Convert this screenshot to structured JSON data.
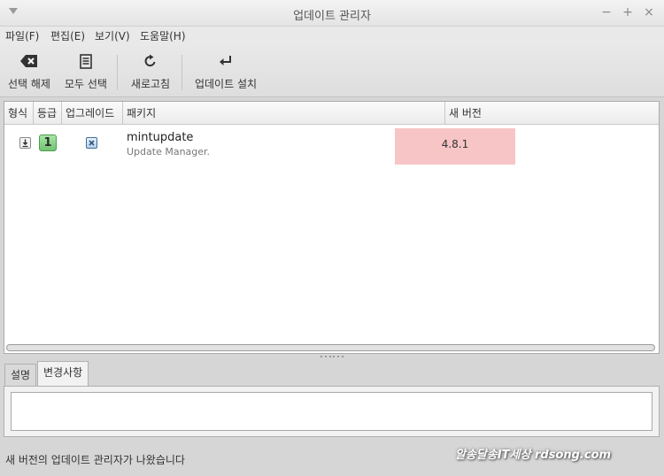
{
  "window": {
    "title": "업데이트 관리자",
    "controls": {
      "minimize": "−",
      "maximize": "+",
      "close": "×"
    }
  },
  "menu": [
    "파일(F)",
    "편집(E)",
    "보기(V)",
    "도움말(H)"
  ],
  "toolbar": {
    "clear": "선택 해제",
    "select_all": "모두 선택",
    "refresh": "새로고침",
    "install": "업데이트 설치"
  },
  "columns": {
    "type": "형식",
    "level": "등급",
    "upgrade": "업그레이드",
    "package": "패키지",
    "new_version": "새 버전"
  },
  "rows": [
    {
      "level": "1",
      "package": "mintupdate",
      "description": "Update Manager.",
      "new_version": "4.8.1",
      "version_highlight": "#f7c5c5"
    }
  ],
  "tabs": [
    "설명",
    "변경사항"
  ],
  "status": "새 버전의 업데이트 관리자가 나왔습니다",
  "watermark": "알송달송IT세상 rdsong.com"
}
